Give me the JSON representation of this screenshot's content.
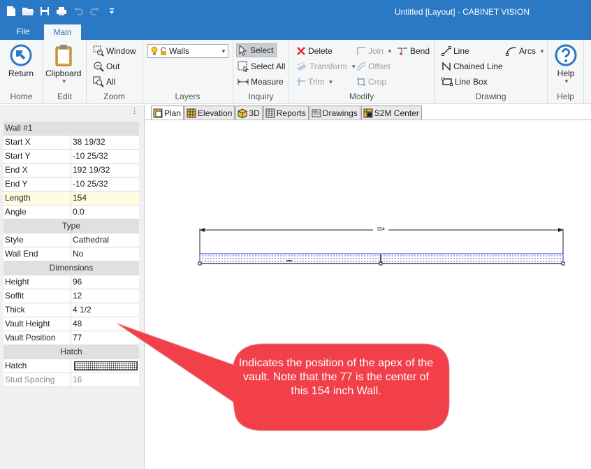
{
  "window": {
    "title": "Untitled [Layout] - CABINET VISION"
  },
  "quick_access": {
    "icons": [
      "new-document-icon",
      "open-folder-icon",
      "save-icon",
      "print-icon",
      "undo-icon",
      "redo-icon",
      "customize-qat-icon"
    ]
  },
  "ribbon_tabs": {
    "file": "File",
    "main": "Main"
  },
  "ribbon": {
    "home": {
      "group_label": "Home",
      "return_label": "Return"
    },
    "edit": {
      "group_label": "Edit",
      "clipboard_label": "Clipboard"
    },
    "zoom": {
      "group_label": "Zoom",
      "window_label": "Window",
      "out_label": "Out",
      "all_label": "All"
    },
    "layers": {
      "group_label": "Layers",
      "combo_value": "Walls"
    },
    "inquiry": {
      "group_label": "Inquiry",
      "select_label": "Select",
      "select_all_label": "Select All",
      "measure_label": "Measure"
    },
    "modify": {
      "group_label": "Modify",
      "delete_label": "Delete",
      "transform_label": "Transform",
      "trim_label": "Trim",
      "join_label": "Join",
      "offset_label": "Offset",
      "crop_label": "Crop",
      "bend_label": "Bend"
    },
    "drawing": {
      "group_label": "Drawing",
      "line_label": "Line",
      "chained_line_label": "Chained Line",
      "line_box_label": "Line Box",
      "arcs_label": "Arcs"
    },
    "help": {
      "group_label": "Help",
      "help_label": "Help"
    }
  },
  "properties": {
    "header": "Wall #1",
    "rows_top": [
      {
        "name": "Start X",
        "value": "38 19/32"
      },
      {
        "name": "Start Y",
        "value": "-10 25/32"
      },
      {
        "name": "End X",
        "value": "192 19/32"
      },
      {
        "name": "End Y",
        "value": "-10 25/32"
      },
      {
        "name": "Length",
        "value": "154"
      },
      {
        "name": "Angle",
        "value": "0.0"
      }
    ],
    "type_section": "Type",
    "rows_type": [
      {
        "name": "Style",
        "value": "Cathedral"
      },
      {
        "name": "Wall End",
        "value": "No"
      }
    ],
    "dimensions_section": "Dimensions",
    "rows_dimensions": [
      {
        "name": "Height",
        "value": "96"
      },
      {
        "name": "Soffit",
        "value": "12"
      },
      {
        "name": "Thick",
        "value": "4 1/2"
      },
      {
        "name": "Vault Height",
        "value": "48"
      },
      {
        "name": "Vault Position",
        "value": "77"
      }
    ],
    "hatch_section": "Hatch",
    "hatch_label": "Hatch",
    "stud_spacing": {
      "name": "Stud Spacing",
      "value": "16"
    }
  },
  "doc_tabs": [
    "Plan",
    "Elevation",
    "3D",
    "Reports",
    "Drawings",
    "S2M Center"
  ],
  "plan": {
    "dimension_text": "154"
  },
  "callout": {
    "text": "Indicates the position of the apex of the vault. Note that the 77 is the center of this 154 inch Wall."
  },
  "colors": {
    "title_bar": "#2b78c4",
    "callout": "#f2404a",
    "wall_line": "#2433d6",
    "highlight_row": "#fefde2"
  }
}
